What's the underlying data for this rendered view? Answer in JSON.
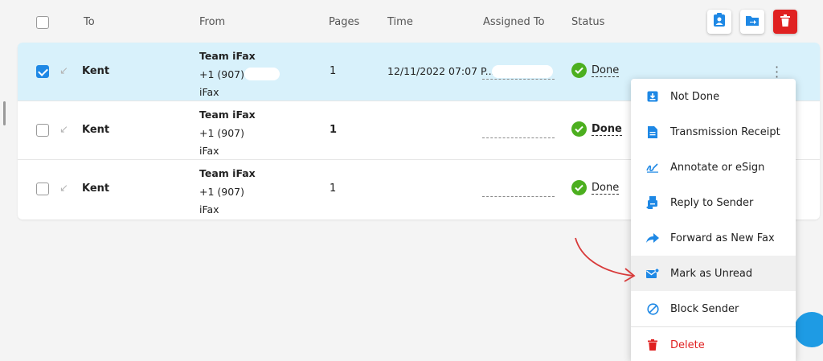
{
  "header": {
    "col_to": "To",
    "col_from": "From",
    "col_pages": "Pages",
    "col_time": "Time",
    "col_assigned": "Assigned To",
    "col_status": "Status",
    "actions": [
      "contact-icon",
      "move-folder-icon",
      "trash-icon"
    ]
  },
  "rows": [
    {
      "selected": true,
      "to": "Kent",
      "from_name": "Team iFax",
      "from_number": "+1 (907)",
      "from_app": "iFax",
      "pages": "1",
      "time": "12/11/2022 07:07 P...",
      "status": "Done"
    },
    {
      "selected": false,
      "to": "Kent",
      "from_name": "Team iFax",
      "from_number": "+1 (907)",
      "from_app": "iFax",
      "pages": "1",
      "time": "",
      "status": "Done"
    },
    {
      "selected": false,
      "to": "Kent",
      "from_name": "Team iFax",
      "from_number": "+1 (907)",
      "from_app": "iFax",
      "pages": "1",
      "time": "",
      "status": "Done"
    }
  ],
  "menu": {
    "items": [
      {
        "label": "Not Done",
        "icon": "download-box-icon"
      },
      {
        "label": "Transmission Receipt",
        "icon": "document-icon"
      },
      {
        "label": "Annotate or eSign",
        "icon": "signature-icon"
      },
      {
        "label": "Reply to Sender",
        "icon": "fax-reply-icon"
      },
      {
        "label": "Forward as New Fax",
        "icon": "forward-arrow-icon"
      },
      {
        "label": "Mark as Unread",
        "icon": "envelope-dot-icon"
      },
      {
        "label": "Block Sender",
        "icon": "block-icon"
      },
      {
        "label": "Delete",
        "icon": "trash-icon"
      }
    ]
  },
  "colors": {
    "accent": "#1e88e5",
    "selected_row": "#d8f1fb",
    "done_green": "#4caf1f",
    "danger_red": "#e02121",
    "annotation_arrow": "#d83a3a"
  }
}
